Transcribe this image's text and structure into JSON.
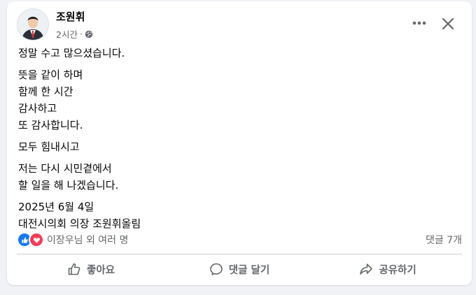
{
  "post": {
    "author": "조원휘",
    "time": "2시간",
    "separator": "·",
    "privacy_icon": "globe-icon",
    "paragraphs": [
      [
        "정말 수고 많으셨습니다."
      ],
      [
        "뜻을 같이 하며",
        "함께 한 시간",
        "감사하고",
        "또 감사합니다."
      ],
      [
        "모두 힘내시고"
      ],
      [
        "저는 다시 시민곁에서",
        "할 일을 해 나겠습니다."
      ],
      [
        "2025년 6월 4일",
        "대전시의회 의장 조원휘올림"
      ]
    ]
  },
  "engagement": {
    "reaction_icons": [
      "like-icon",
      "love-icon"
    ],
    "reaction_names": "이장우님 외 여러 명",
    "comment_count": "댓글 7개"
  },
  "actions": {
    "like": "좋아요",
    "comment": "댓글 달기",
    "share": "공유하기"
  },
  "colors": {
    "like_blue": "#1877f2",
    "love_red": "#f33e58",
    "muted_text": "#65676b"
  }
}
